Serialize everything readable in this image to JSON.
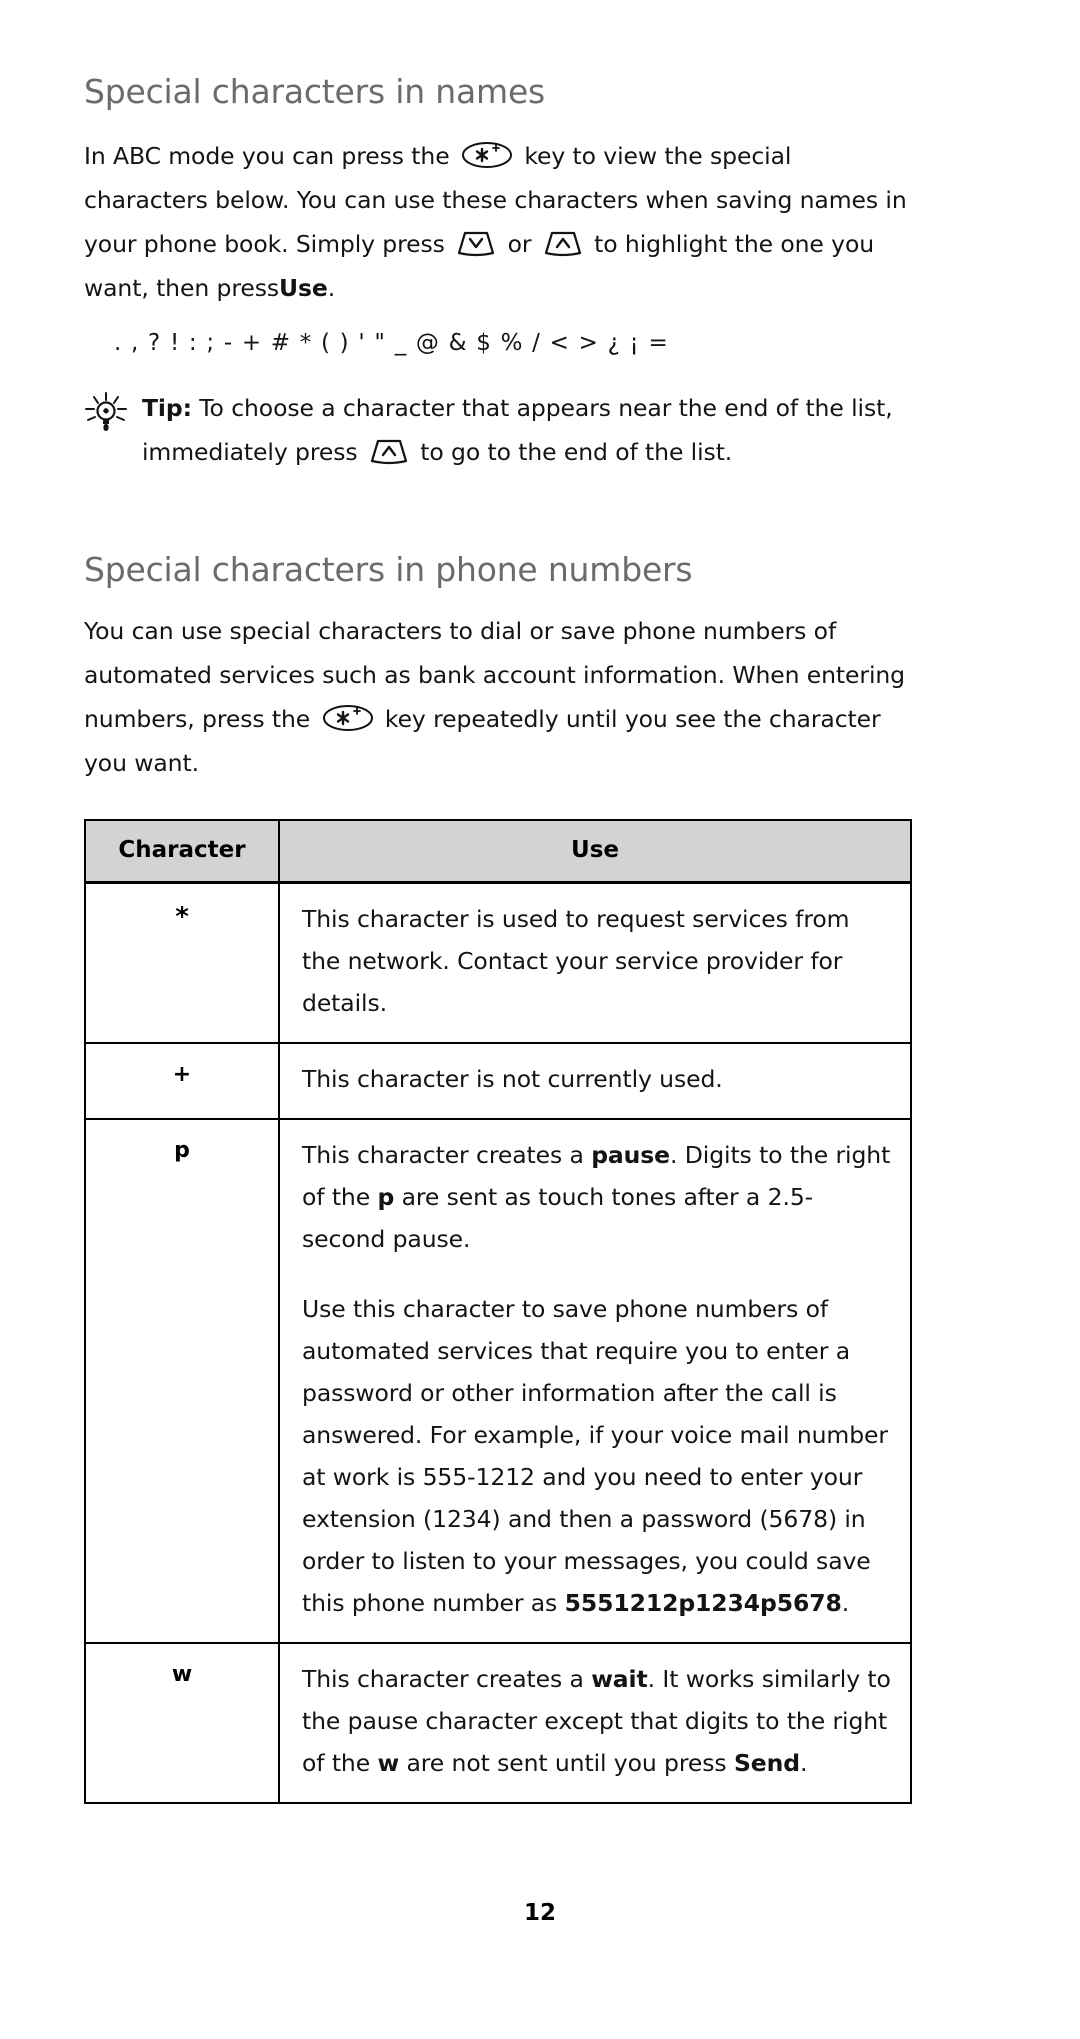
{
  "section_names": {
    "heading": "Special characters in names",
    "paragraph_part1": "In ABC mode you can press the",
    "paragraph_part2": "key to view the special characters below. You can use these characters when saving names in your phone book. Simply press",
    "paragraph_or": "or",
    "paragraph_part3": "to highlight the one you want, then press",
    "paragraph_use_bold": "Use",
    "paragraph_end": ".",
    "special_characters_line": ". , ? ! : ; - + # * ( ) ' \" _ @ & $ % / < > ¿ ¡ ="
  },
  "tip": {
    "label": "Tip:",
    "text_part1": "To choose a character that appears near the end of the list, immediately press",
    "text_part2": "to go to the end of the list.",
    "icon": "lightbulb-icon"
  },
  "section_phone": {
    "heading": "Special characters in phone numbers",
    "paragraph_part1": "You can use special characters to dial or save phone numbers of automated services such as bank account information. When entering numbers, press the",
    "paragraph_part2": "key repeatedly until you see the character you want."
  },
  "icons": {
    "star_key": "star-plus-key-icon",
    "scroll_down_key": "scroll-down-key-icon",
    "scroll_up_key": "scroll-up-key-icon"
  },
  "table": {
    "headers": {
      "character": "Character",
      "use": "Use"
    },
    "rows": [
      {
        "character": "*",
        "paragraphs": [
          [
            {
              "t": "This character is used to request services from the network. Contact your service provider for details.",
              "b": false
            }
          ]
        ]
      },
      {
        "character": "+",
        "paragraphs": [
          [
            {
              "t": "This character is not currently used.",
              "b": false
            }
          ]
        ]
      },
      {
        "character": "p",
        "paragraphs": [
          [
            {
              "t": "This character creates a ",
              "b": false
            },
            {
              "t": "pause",
              "b": true
            },
            {
              "t": ". Digits to the right of the ",
              "b": false
            },
            {
              "t": "p",
              "b": true
            },
            {
              "t": " are sent as touch tones after a 2.5-second pause.",
              "b": false
            }
          ],
          [
            {
              "t": "Use this character to save phone numbers of automated services that require you to enter a password or other information after the call is answered. For example, if your voice mail number at work is 555-1212 and you need to enter your extension (1234) and then a password (5678) in order to listen to your messages, you could save this phone number as ",
              "b": false
            },
            {
              "t": "5551212p1234p5678",
              "b": true
            },
            {
              "t": ".",
              "b": false
            }
          ]
        ]
      },
      {
        "character": "w",
        "paragraphs": [
          [
            {
              "t": "This character creates a ",
              "b": false
            },
            {
              "t": "wait",
              "b": true
            },
            {
              "t": ". It works similarly to the pause character except that digits to the right of the ",
              "b": false
            },
            {
              "t": "w",
              "b": true
            },
            {
              "t": " are not sent until you press ",
              "b": false
            },
            {
              "t": "Send",
              "b": true
            },
            {
              "t": ".",
              "b": false
            }
          ]
        ]
      }
    ]
  },
  "footer": {
    "page_number": "12"
  },
  "colors": {
    "heading": "#6b6b6b",
    "body_text": "#141414",
    "table_header_bg": "#d3d3d3",
    "table_border": "#000000"
  }
}
